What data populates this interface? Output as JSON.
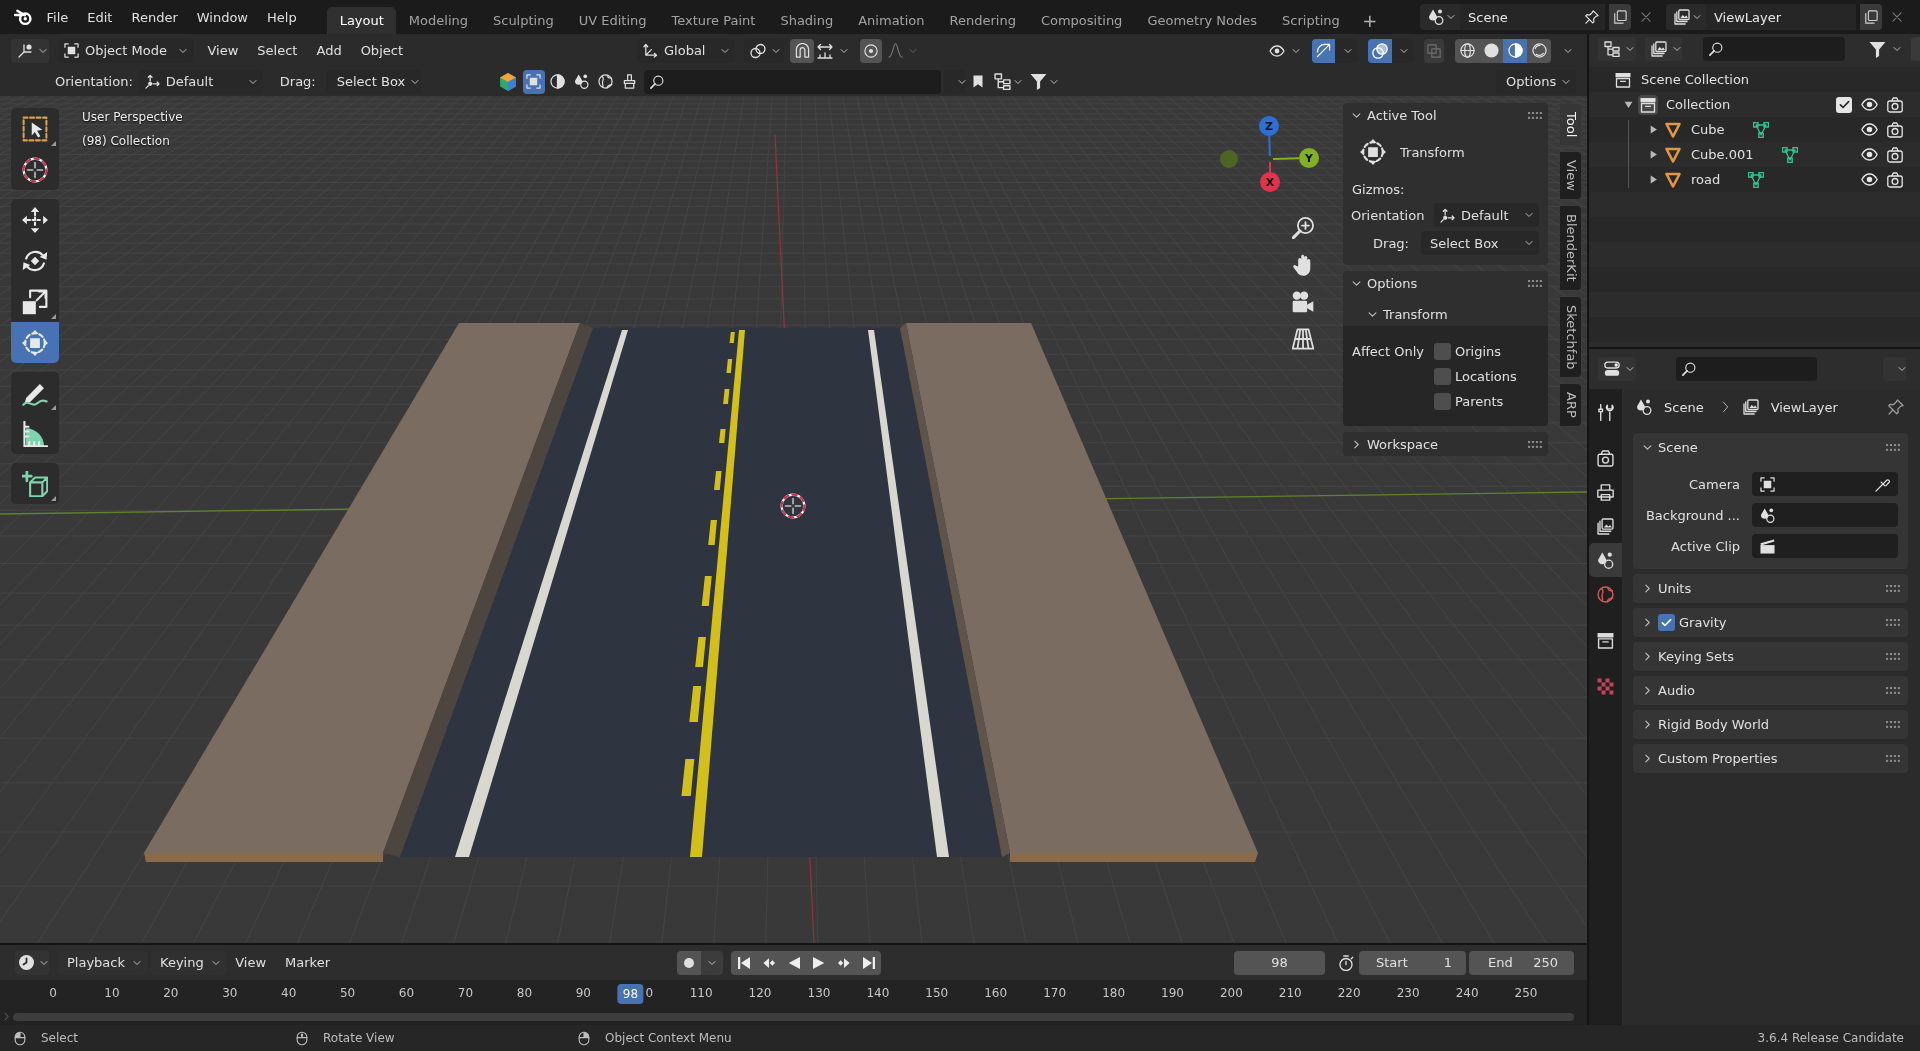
{
  "topbar": {
    "menus": [
      "File",
      "Edit",
      "Render",
      "Window",
      "Help"
    ],
    "workspaces": [
      {
        "label": "Layout",
        "selected": true
      },
      {
        "label": "Modeling",
        "selected": false
      },
      {
        "label": "Sculpting",
        "selected": false
      },
      {
        "label": "UV Editing",
        "selected": false
      },
      {
        "label": "Texture Paint",
        "selected": false
      },
      {
        "label": "Shading",
        "selected": false
      },
      {
        "label": "Animation",
        "selected": false
      },
      {
        "label": "Rendering",
        "selected": false
      },
      {
        "label": "Compositing",
        "selected": false
      },
      {
        "label": "Geometry Nodes",
        "selected": false
      },
      {
        "label": "Scripting",
        "selected": false
      }
    ],
    "add_workspace": "+",
    "scene": "Scene",
    "view_layer": "ViewLayer"
  },
  "viewport_header": {
    "mode": "Object Mode",
    "menus": [
      "View",
      "Select",
      "Add",
      "Object"
    ],
    "transform_orientation": "Global",
    "snap": {
      "on": false
    },
    "proportional_editing": {
      "on": false
    },
    "falloff": {
      "disabled": true
    },
    "gizmos": {
      "on": true
    },
    "overlays": {
      "on": true
    },
    "xray": {
      "on": false,
      "disabled": true
    },
    "shading": [
      {
        "kind": "wireframe",
        "selected": false
      },
      {
        "kind": "solid",
        "selected": false
      },
      {
        "kind": "material",
        "selected": true
      },
      {
        "kind": "rendered",
        "selected": false
      }
    ]
  },
  "tool_settings": {
    "orientation_label": "Orientation:",
    "orientation": "Default",
    "drag_label": "Drag:",
    "drag": "Select Box",
    "asset_types": [
      {
        "kind": "model",
        "selected": true
      },
      {
        "kind": "material",
        "selected": false
      },
      {
        "kind": "scene",
        "selected": false
      },
      {
        "kind": "hdr",
        "selected": false
      },
      {
        "kind": "brush",
        "selected": false
      }
    ],
    "options": "Options"
  },
  "viewport": {
    "view_name": "User Perspective",
    "collection": "(98) Collection",
    "tools": [
      [
        {
          "kind": "select_box",
          "selected": false
        },
        {
          "kind": "cursor",
          "selected": false
        }
      ],
      [
        {
          "kind": "move",
          "selected": false
        },
        {
          "kind": "rotate",
          "selected": false
        },
        {
          "kind": "scale",
          "selected": false
        },
        {
          "kind": "transform",
          "selected": true
        }
      ],
      [
        {
          "kind": "annotate",
          "selected": false
        },
        {
          "kind": "measure",
          "selected": false
        }
      ],
      [
        {
          "kind": "add_cube",
          "selected": false
        }
      ]
    ],
    "gizmo_axes": [
      {
        "label": "Z",
        "color": "#2f6ed4"
      },
      {
        "label": "Y",
        "color": "#82b128"
      },
      {
        "label": "X",
        "color": "#e2324d"
      }
    ]
  },
  "sidebar": {
    "tabs": [
      {
        "label": "Tool",
        "selected": true
      },
      {
        "label": "View",
        "selected": false
      },
      {
        "label": "BlenderKit",
        "selected": false
      },
      {
        "label": "Sketchfab",
        "selected": false
      },
      {
        "label": "ARP",
        "selected": false
      }
    ],
    "active_tool": {
      "title": "Active Tool",
      "expanded": true,
      "tool": "Transform",
      "gizmos_label": "Gizmos:",
      "orientation_label": "Orientation",
      "orientation": "Default",
      "drag_label": "Drag:",
      "drag": "Select Box"
    },
    "options": {
      "title": "Options",
      "expanded": true,
      "transform": {
        "title": "Transform",
        "expanded": true,
        "affect_label": "Affect Only",
        "checkboxes": [
          {
            "label": "Origins",
            "checked": false
          },
          {
            "label": "Locations",
            "checked": false
          },
          {
            "label": "Parents",
            "checked": false
          }
        ]
      }
    },
    "workspace": {
      "title": "Workspace",
      "expanded": false
    }
  },
  "outliner": {
    "tree": [
      {
        "label": "Scene Collection",
        "kind": "scene_collection",
        "children": [
          {
            "label": "Collection",
            "kind": "collection",
            "expanded": true,
            "checked": true,
            "children": [
              {
                "label": "Cube",
                "kind": "mesh",
                "expanded": false
              },
              {
                "label": "Cube.001",
                "kind": "mesh",
                "expanded": false
              },
              {
                "label": "road",
                "kind": "mesh",
                "expanded": false
              }
            ]
          }
        ]
      }
    ]
  },
  "properties": {
    "tabs": [
      [
        {
          "kind": "tool",
          "selected": false
        }
      ],
      [
        {
          "kind": "render",
          "selected": false
        },
        {
          "kind": "output",
          "selected": false
        },
        {
          "kind": "view_layer",
          "selected": false
        },
        {
          "kind": "scene",
          "selected": true
        },
        {
          "kind": "world",
          "selected": false
        }
      ],
      [
        {
          "kind": "collection",
          "selected": false
        }
      ],
      [
        {
          "kind": "texture",
          "selected": false
        }
      ]
    ],
    "breadcrumb": [
      {
        "label": "Scene",
        "kind": "scene"
      },
      {
        "label": "ViewLayer",
        "kind": "view_layer"
      }
    ],
    "panels": [
      {
        "title": "Scene",
        "expanded": true,
        "fields": [
          {
            "label": "Camera",
            "kind": "object"
          },
          {
            "label": "Background ...",
            "kind": "scene"
          },
          {
            "label": "Active Clip",
            "kind": "clip"
          }
        ]
      },
      {
        "title": "Units",
        "expanded": false
      },
      {
        "title": "Gravity",
        "expanded": false,
        "checked": true
      },
      {
        "title": "Keying Sets",
        "expanded": false
      },
      {
        "title": "Audio",
        "expanded": false
      },
      {
        "title": "Rigid Body World",
        "expanded": false
      },
      {
        "title": "Custom Properties",
        "expanded": false
      }
    ]
  },
  "timeline": {
    "menus": [
      {
        "label": "Playback",
        "kind": "dropdown"
      },
      {
        "label": "Keying",
        "kind": "dropdown"
      },
      {
        "label": "View",
        "kind": "menu"
      },
      {
        "label": "Marker",
        "kind": "menu"
      }
    ],
    "current_frame": "98",
    "start_label": "Start",
    "start": "1",
    "end_label": "End",
    "end": "250",
    "ruler": [
      "0",
      "10",
      "20",
      "30",
      "40",
      "50",
      "60",
      "70",
      "80",
      "90",
      "0",
      "110",
      "120",
      "130",
      "140",
      "150",
      "160",
      "170",
      "180",
      "190",
      "200",
      "210",
      "220",
      "230",
      "240",
      "250"
    ],
    "playhead": {
      "label": "98",
      "level": 0.392
    }
  },
  "statusbar": {
    "hints": [
      "Select",
      "Rotate View",
      "Object Context Menu"
    ],
    "version": "3.6.4 Release Candidate"
  }
}
